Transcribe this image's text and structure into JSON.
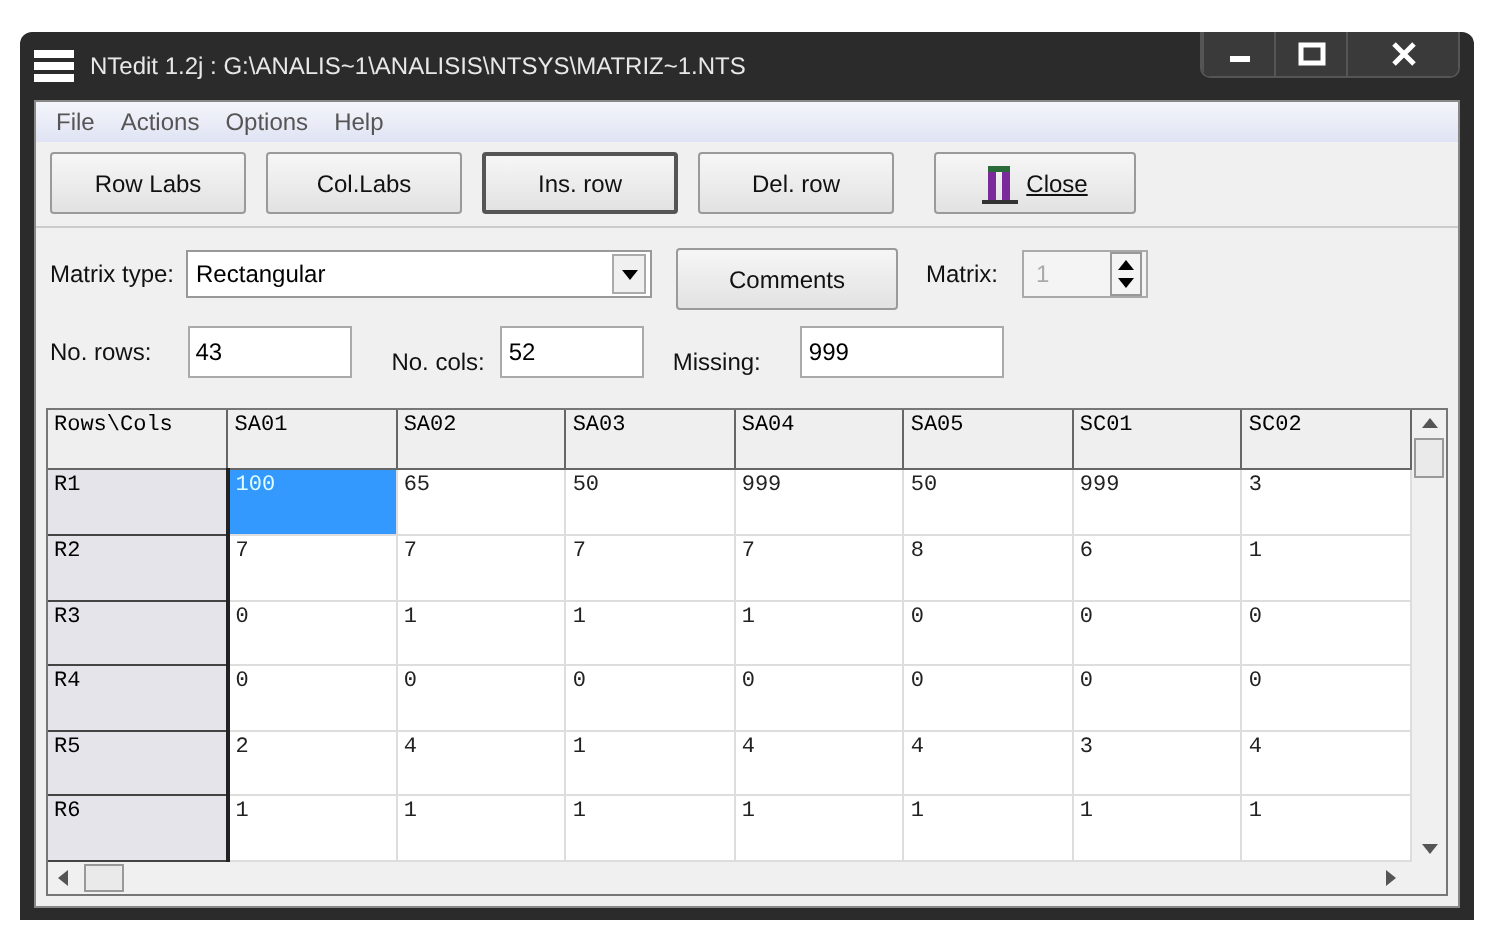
{
  "window": {
    "title": "NTedit 1.2j : G:\\ANALIS~1\\ANALISIS\\NTSYS\\MATRIZ~1.NTS"
  },
  "menu": [
    "File",
    "Actions",
    "Options",
    "Help"
  ],
  "toolbar": [
    {
      "label": "Row Labs",
      "pressed": false,
      "kind": "text"
    },
    {
      "label": "Col.Labs",
      "pressed": false,
      "kind": "text"
    },
    {
      "label": "Ins. row",
      "pressed": true,
      "kind": "text"
    },
    {
      "label": "Del. row",
      "pressed": false,
      "kind": "text"
    },
    {
      "label": "Close",
      "pressed": false,
      "kind": "close"
    }
  ],
  "matrix_type": {
    "label": "Matrix type:",
    "value": "Rectangular"
  },
  "comments_button": "Comments",
  "matrix": {
    "label": "Matrix:",
    "value": "1",
    "disabled": true
  },
  "fields": [
    {
      "label": "No. rows:",
      "value": "43"
    },
    {
      "label": "No. cols:",
      "value": "52"
    },
    {
      "label": "Missing:",
      "value": "999"
    }
  ],
  "grid": {
    "corner": "Rows\\Cols",
    "columns": [
      "SA01",
      "SA02",
      "SA03",
      "SA04",
      "SA05",
      "SC01",
      "SC02"
    ],
    "rows": [
      {
        "label": "R1",
        "cells": [
          {
            "text": "100",
            "selected": true
          },
          {
            "text": "65",
            "selected": false
          },
          {
            "text": "50",
            "selected": false
          },
          {
            "text": "999",
            "selected": false
          },
          {
            "text": "50",
            "selected": false
          },
          {
            "text": "999",
            "selected": false
          },
          {
            "text": "3",
            "selected": false
          }
        ]
      },
      {
        "label": "R2",
        "cells": [
          {
            "text": "7",
            "selected": false
          },
          {
            "text": "7",
            "selected": false
          },
          {
            "text": "7",
            "selected": false
          },
          {
            "text": "7",
            "selected": false
          },
          {
            "text": "8",
            "selected": false
          },
          {
            "text": "6",
            "selected": false
          },
          {
            "text": "1",
            "selected": false
          }
        ]
      },
      {
        "label": "R3",
        "cells": [
          {
            "text": "0",
            "selected": false
          },
          {
            "text": "1",
            "selected": false
          },
          {
            "text": "1",
            "selected": false
          },
          {
            "text": "1",
            "selected": false
          },
          {
            "text": "0",
            "selected": false
          },
          {
            "text": "0",
            "selected": false
          },
          {
            "text": "0",
            "selected": false
          }
        ]
      },
      {
        "label": "R4",
        "cells": [
          {
            "text": "0",
            "selected": false
          },
          {
            "text": "0",
            "selected": false
          },
          {
            "text": "0",
            "selected": false
          },
          {
            "text": "0",
            "selected": false
          },
          {
            "text": "0",
            "selected": false
          },
          {
            "text": "0",
            "selected": false
          },
          {
            "text": "0",
            "selected": false
          }
        ]
      },
      {
        "label": "R5",
        "cells": [
          {
            "text": "2",
            "selected": false
          },
          {
            "text": "4",
            "selected": false
          },
          {
            "text": "1",
            "selected": false
          },
          {
            "text": "4",
            "selected": false
          },
          {
            "text": "4",
            "selected": false
          },
          {
            "text": "3",
            "selected": false
          },
          {
            "text": "4",
            "selected": false
          }
        ]
      },
      {
        "label": "R6",
        "cells": [
          {
            "text": "1",
            "selected": false
          },
          {
            "text": "1",
            "selected": false
          },
          {
            "text": "1",
            "selected": false
          },
          {
            "text": "1",
            "selected": false
          },
          {
            "text": "1",
            "selected": false
          },
          {
            "text": "1",
            "selected": false
          },
          {
            "text": "1",
            "selected": false
          }
        ]
      }
    ]
  }
}
